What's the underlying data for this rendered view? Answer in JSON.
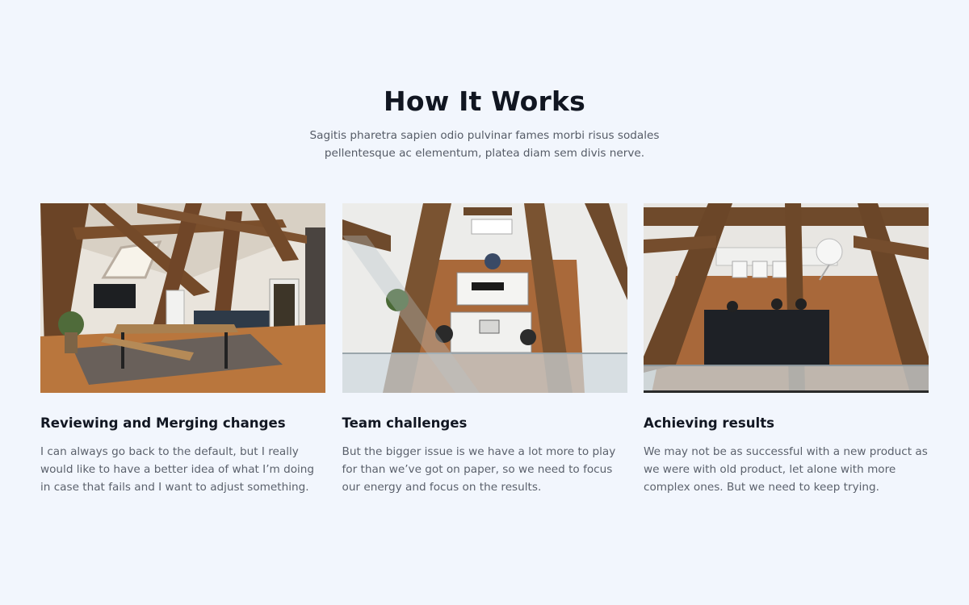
{
  "section": {
    "title": "How It Works",
    "subtitle": "Sagitis pharetra sapien odio pulvinar fames morbi risus sodales pellentesque ac elementum, platea diam sem divis nerve."
  },
  "cards": [
    {
      "image": "office-loft-kitchen-photo",
      "title": "Reviewing and Merging changes",
      "text": "I can always go back to the default, but I really would like to have a better idea of what I’m doing in case that fails and I want to adjust something."
    },
    {
      "image": "team-working-overhead-photo",
      "title": "Team challenges",
      "text": "But the bigger issue is we have a lot more to play for than we’ve got on paper, so we need to focus our energy and focus on the results."
    },
    {
      "image": "meeting-room-overhead-photo",
      "title": "Achieving results",
      "text": "We may not be as successful with a new product as we were with old product, let alone with more complex ones. But we need to keep trying."
    }
  ]
}
